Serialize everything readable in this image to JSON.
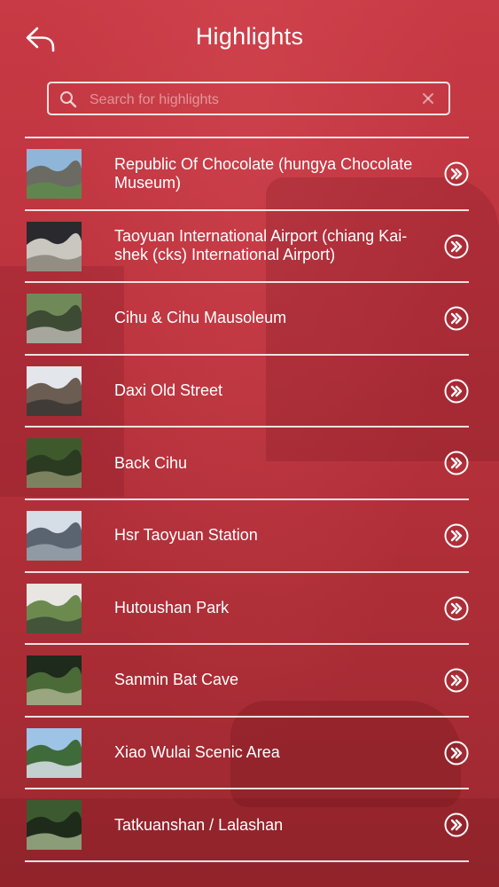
{
  "header": {
    "title": "Highlights",
    "back_icon": "back-arrow-icon"
  },
  "search": {
    "placeholder": "Search for highlights",
    "value": "",
    "icon": "search-icon",
    "clear_icon": "close-icon"
  },
  "colors": {
    "background": "#b5343d",
    "text": "#ffffff"
  },
  "items": [
    {
      "label": "Republic Of Chocolate (hungya Chocolate Museum)",
      "thumb_colors": [
        "#8fb6d8",
        "#6b6a63",
        "#5f8a4a"
      ]
    },
    {
      "label": "Taoyuan International Airport (chiang Kai-shek (cks) International Airport)",
      "thumb_colors": [
        "#2a2a2e",
        "#c9c7c0",
        "#8a8478"
      ]
    },
    {
      "label": "Cihu & Cihu Mausoleum",
      "thumb_colors": [
        "#6f8a58",
        "#3d4a34",
        "#b8b6b0"
      ]
    },
    {
      "label": "Daxi Old Street",
      "thumb_colors": [
        "#e3e6ea",
        "#6b5d52",
        "#3a3534"
      ]
    },
    {
      "label": "Back Cihu",
      "thumb_colors": [
        "#3e5a2d",
        "#2a3b21",
        "#8b8f6a"
      ]
    },
    {
      "label": "Hsr Taoyuan Station",
      "thumb_colors": [
        "#d5dde6",
        "#5a6470",
        "#9aa3ad"
      ]
    },
    {
      "label": "Hutoushan Park",
      "thumb_colors": [
        "#e7e6e2",
        "#6c8a4e",
        "#3b4a36"
      ]
    },
    {
      "label": "Sanmin Bat Cave",
      "thumb_colors": [
        "#1e2a1c",
        "#4a6a38",
        "#a7b08d"
      ]
    },
    {
      "label": "Xiao Wulai Scenic Area",
      "thumb_colors": [
        "#9dc4e6",
        "#3f6a3a",
        "#d9e2ea"
      ]
    },
    {
      "label": "Tatkuanshan / Lalashan",
      "thumb_colors": [
        "#3c5a30",
        "#1f2b1a",
        "#9fb08a"
      ]
    }
  ],
  "row_action_icon": "double-chevron-right-icon"
}
